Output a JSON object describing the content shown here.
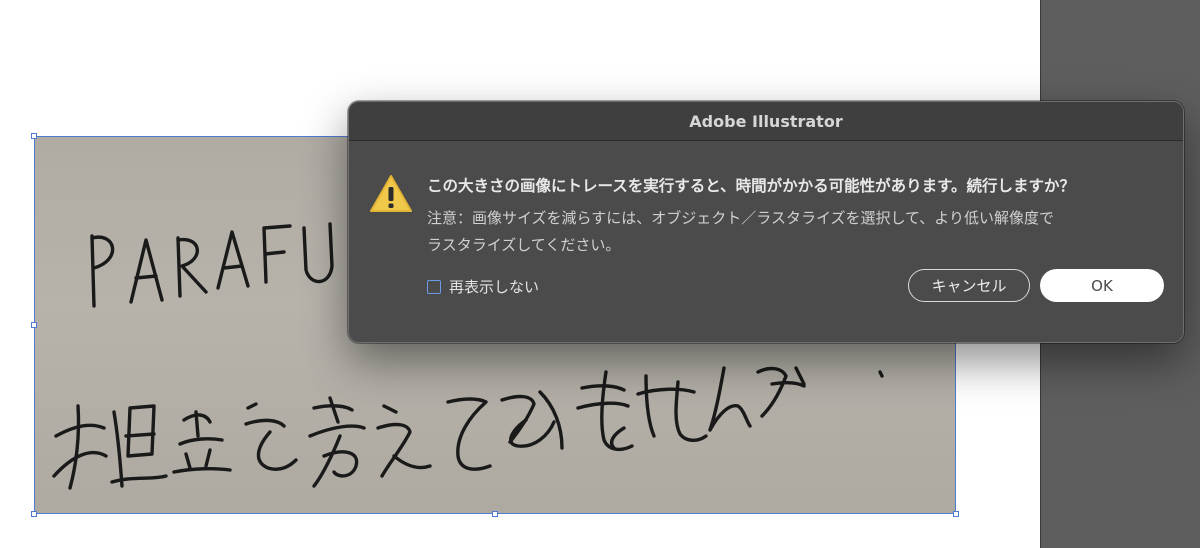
{
  "dialog": {
    "title": "Adobe Illustrator",
    "icon": "warning-icon",
    "heading": "この大きさの画像にトレースを実行すると、時間がかかる可能性があります。続行しますか？",
    "note_line1": "注意：画像サイズを減らすには、オブジェクト／ラスタライズを選択して、より低い解像度で",
    "note_line2": "ラスタライズしてください。",
    "checkbox_label": "再表示しない",
    "checkbox_checked": false,
    "cancel_label": "キャンセル",
    "ok_label": "OK"
  },
  "colors": {
    "selection": "#4f7bd3",
    "dialog_bg": "#4b4b4b",
    "warning": "#f1c94a",
    "panel": "#5e5e5e"
  }
}
